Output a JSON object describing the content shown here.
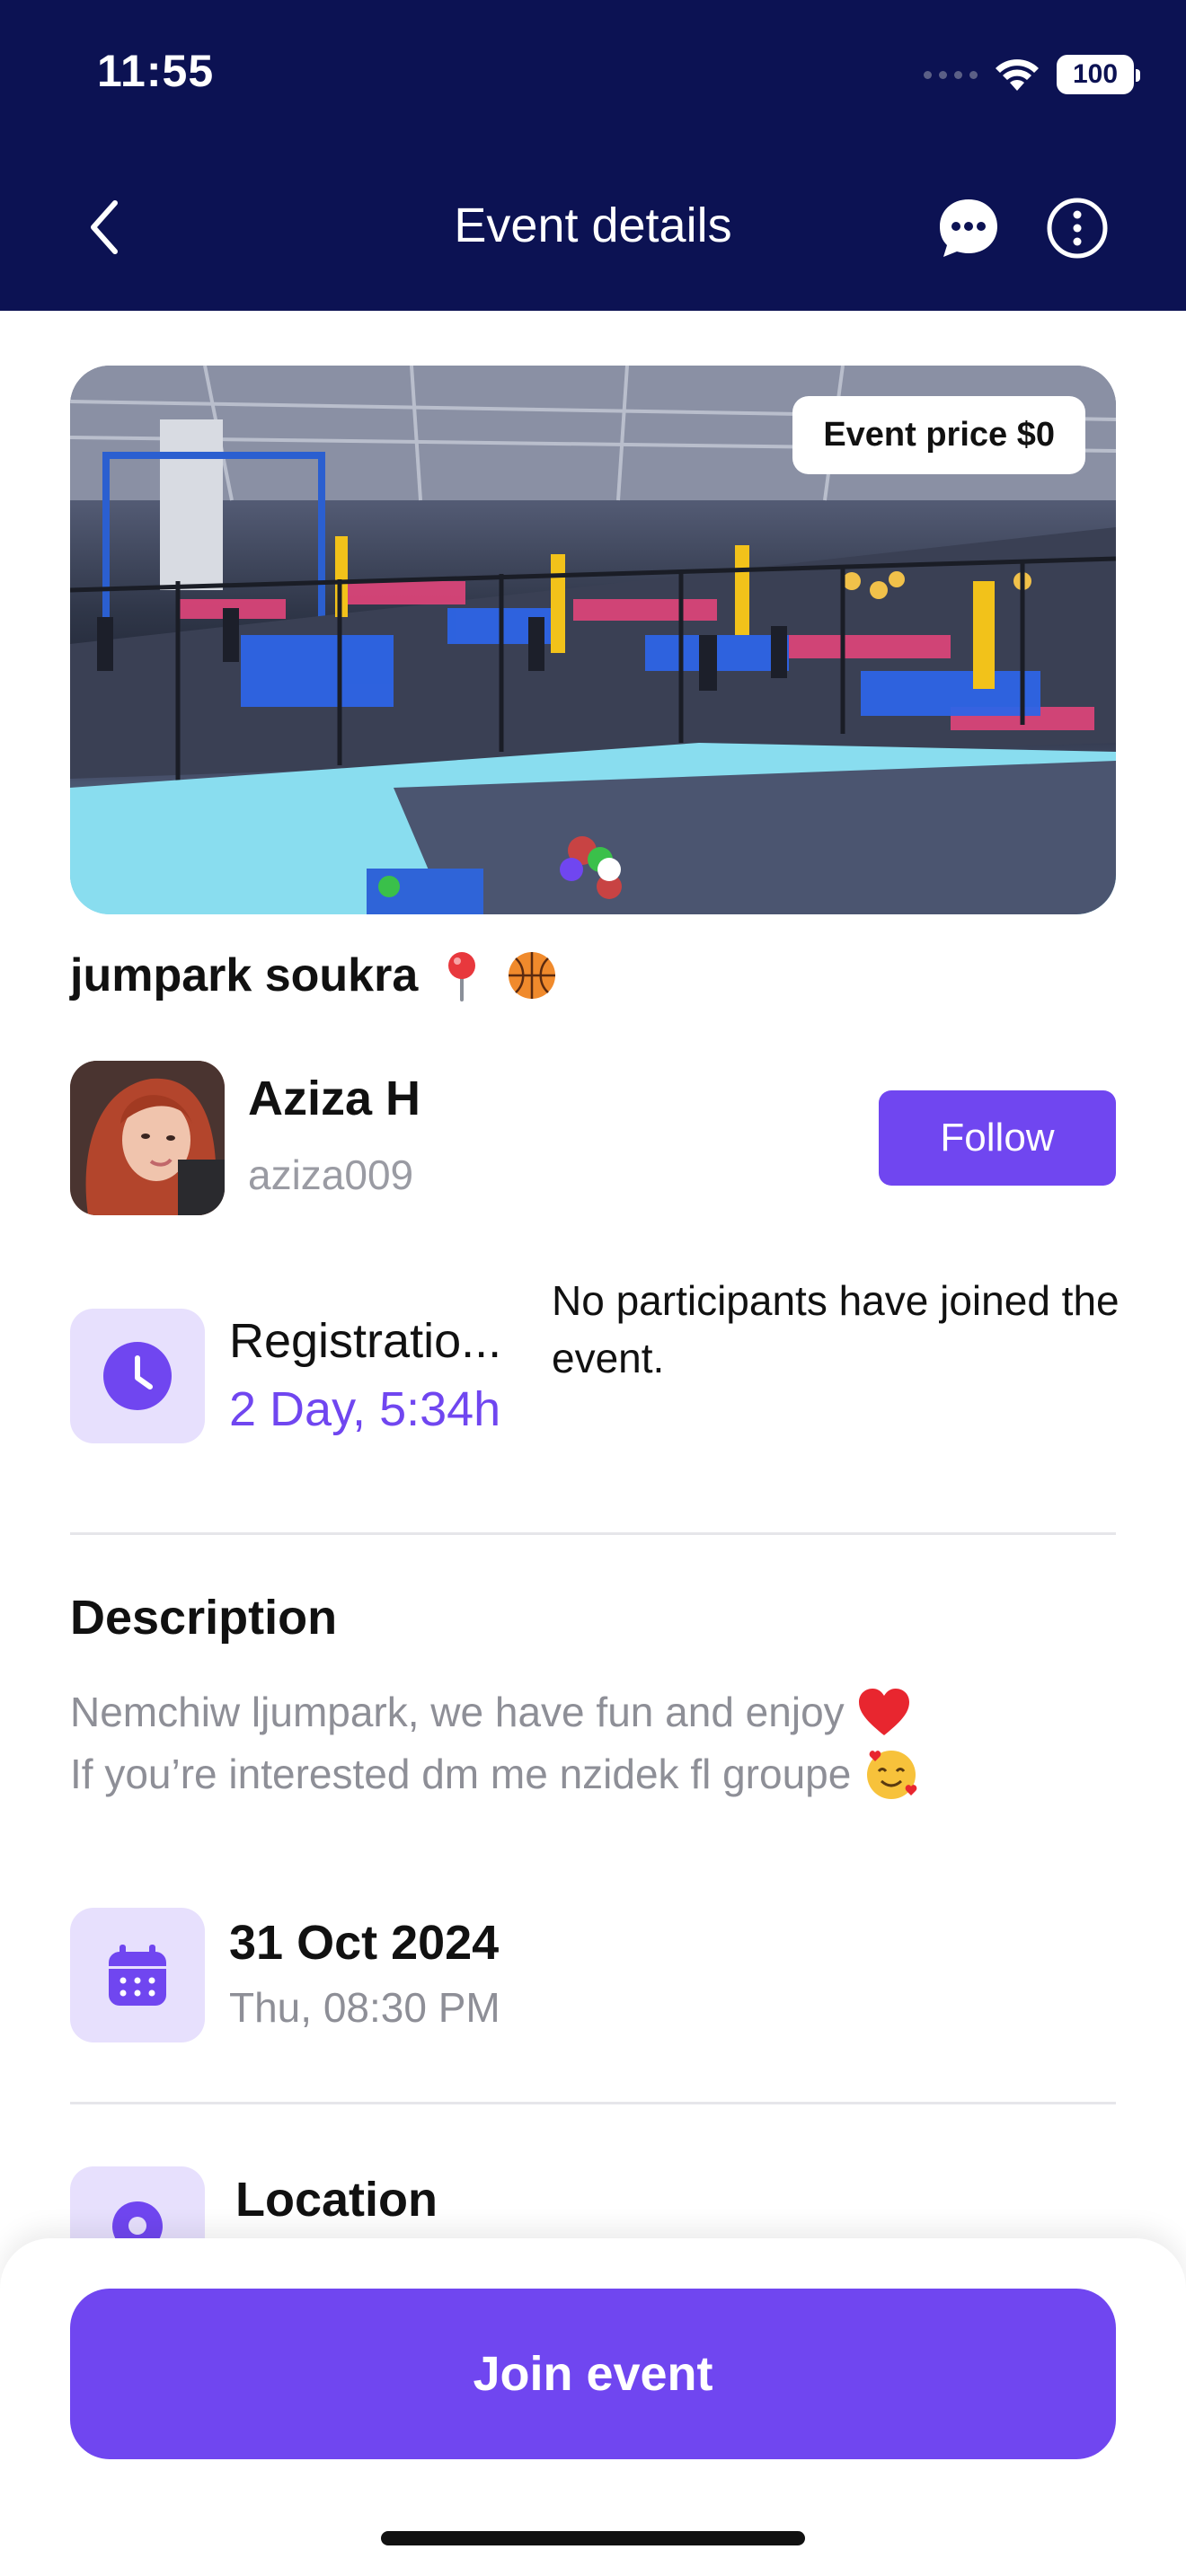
{
  "status_bar": {
    "time": "11:55",
    "battery": "100"
  },
  "header": {
    "title": "Event details"
  },
  "hero": {
    "price_badge": "Event price $0",
    "slide_count": 2,
    "active_slide": 1
  },
  "event": {
    "title": "jumpark soukra"
  },
  "host": {
    "name": "Aziza H",
    "username": "aziza009",
    "follow_label": "Follow"
  },
  "registration": {
    "label": "Registratio...",
    "countdown": "2 Day, 5:34h"
  },
  "participants": {
    "text": "No participants have joined the event."
  },
  "description": {
    "title": "Description",
    "line1": "Nemchiw ljumpark, we have fun and enjoy",
    "line2": "If you’re interested dm me nzidek fl groupe"
  },
  "date": {
    "main": "31 Oct 2024",
    "sub": "Thu, 08:30 PM"
  },
  "location": {
    "title": "Location"
  },
  "actions": {
    "join_label": "Join event"
  },
  "colors": {
    "header_bg": "#0c1253",
    "accent": "#7046f0",
    "tile_bg": "#e7e0fd",
    "muted_text": "#8e8f97"
  }
}
